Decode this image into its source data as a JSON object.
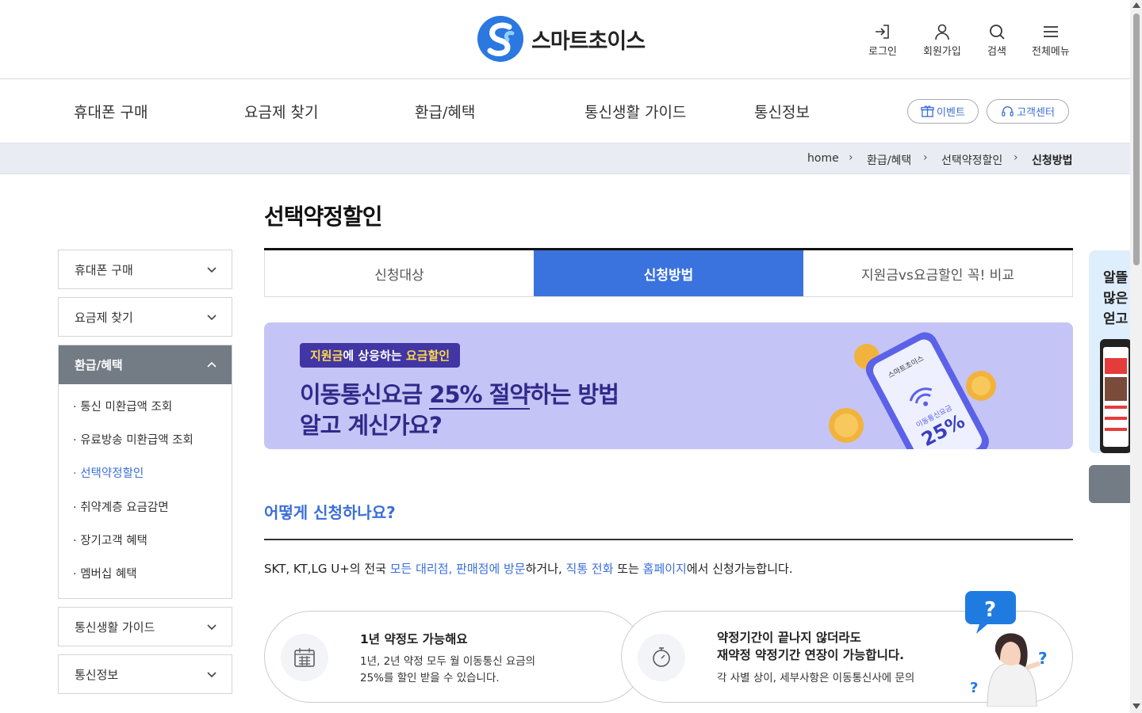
{
  "header": {
    "logo_text": "스마트초이스",
    "utils": [
      {
        "label": "로그인",
        "icon": "login-icon"
      },
      {
        "label": "회원가입",
        "icon": "user-icon"
      },
      {
        "label": "검색",
        "icon": "search-icon"
      },
      {
        "label": "전체메뉴",
        "icon": "menu-icon"
      }
    ]
  },
  "gnb": {
    "items": [
      "휴대폰 구매",
      "요금제 찾기",
      "환급/혜택",
      "통신생활 가이드",
      "통신정보"
    ],
    "event_label": "이벤트",
    "support_label": "고객센터"
  },
  "breadcrumb": [
    "home",
    "환급/혜택",
    "선택약정할인",
    "신청방법"
  ],
  "sidebar": {
    "groups": [
      "휴대폰 구매",
      "요금제 찾기",
      "환급/혜택",
      "통신생활 가이드",
      "통신정보"
    ],
    "open_items": [
      "통신 미환급액 조회",
      "유료방송 미환급액 조회",
      "선택약정할인",
      "취약계층 요금감면",
      "장기고객 혜택",
      "멤버십 혜택"
    ]
  },
  "main": {
    "title": "선택약정할인",
    "tabs": [
      "신청대상",
      "신청방법",
      "지원금vs요금할인 꼭! 비교"
    ],
    "active_tab": "신청방법",
    "banner": {
      "badge_part1": "지원금",
      "badge_part2": "에 상응하는 ",
      "badge_part3": "요금할인",
      "line1_a": "이동통신요금 ",
      "line1_b": "25% 절약",
      "line1_c": "하는 방법",
      "line2": "알고 계신가요?",
      "phone_logo": "스마트초이스",
      "phone_caption": "이동통신요금",
      "phone_percent": "25%"
    },
    "section_title": "어떻게 신청하나요?",
    "desc": {
      "p1": "SKT, KT,LG U+의 전국 ",
      "h1": "모든 대리점, 판매점에 방문",
      "p2": "하거나, ",
      "h2": "직통 전화",
      "p3": " 또는 ",
      "h3": "홈페이지",
      "p4": "에서 신청가능합니다."
    },
    "cards": [
      {
        "title": "1년 약정도 가능해요",
        "line1": "1년, 2년 약정 모두 월 이동통신 요금의",
        "line2": "25%를 할인 받을 수 있습니다.",
        "icon": "calendar-icon"
      },
      {
        "title_line1": "약정기간이 끝나지 않더라도",
        "title_line2": "재약정 약정기간 연장이 가능합니다.",
        "line1": "각 사별 상이, 세부사항은 이동통신사에 문의",
        "icon": "timer-icon"
      }
    ],
    "question_mark": "?"
  },
  "promo": {
    "lines": [
      "알뜰",
      "많은",
      "얻고"
    ]
  },
  "colors": {
    "accent": "#3a73de",
    "banner_bg": "#c5c4f7",
    "banner_text": "#2f2a8a",
    "sidebar_open": "#737b84"
  }
}
